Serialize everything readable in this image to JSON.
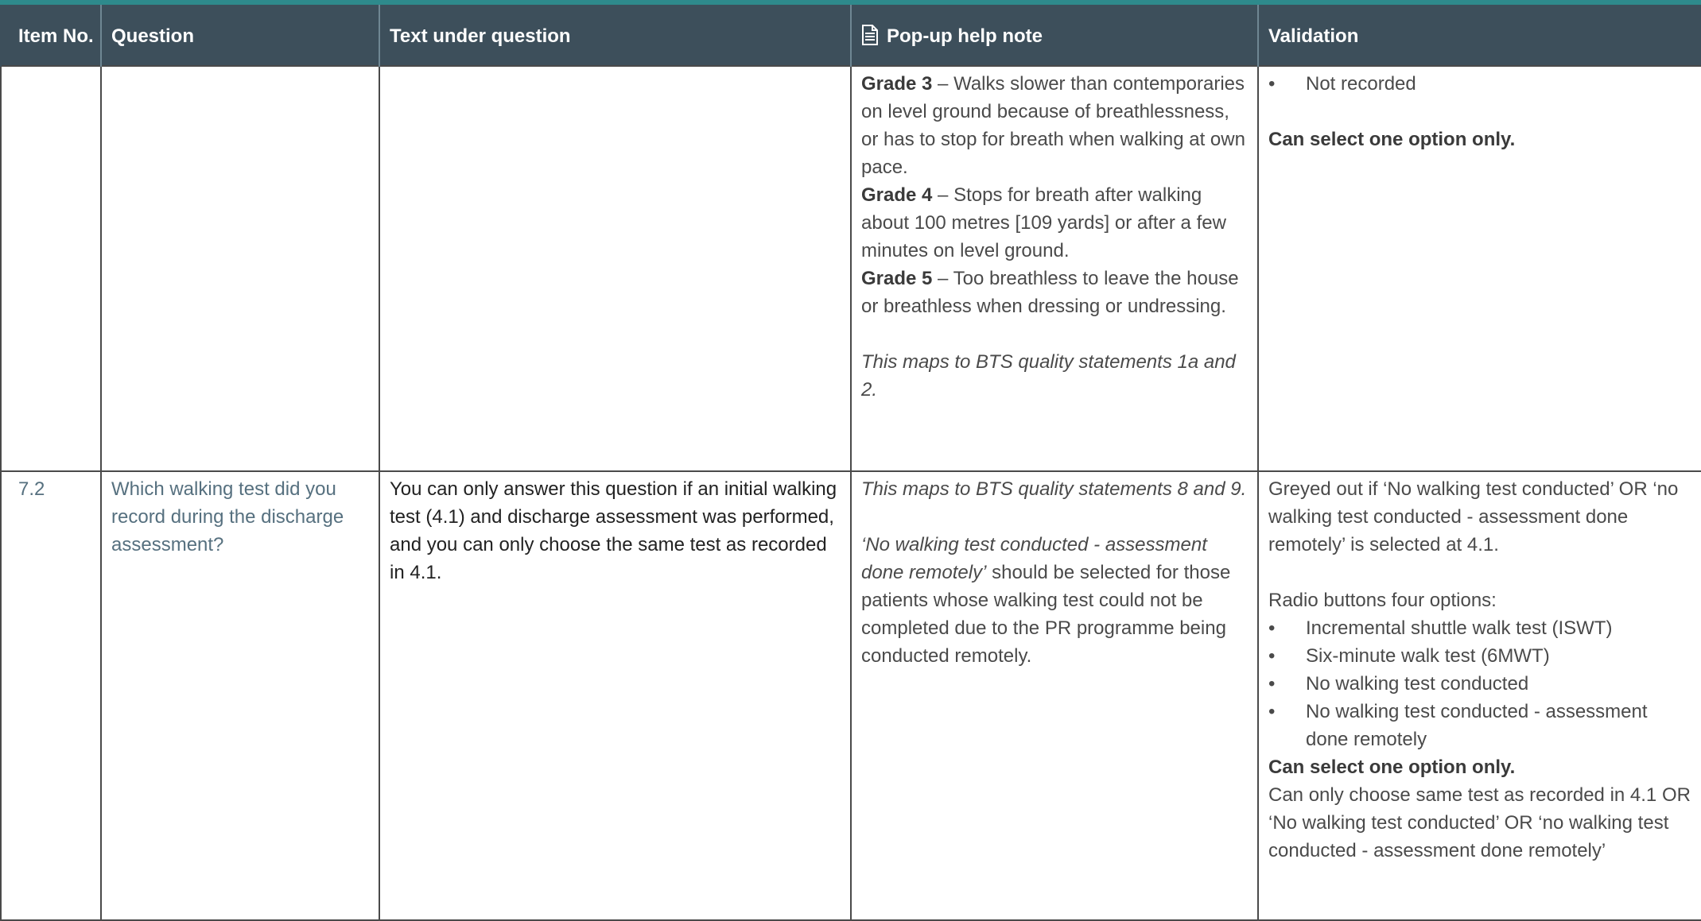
{
  "header": {
    "item_no": "Item No.",
    "question": "Question",
    "text_under": "Text under question",
    "help": "Pop-up help note",
    "help_icon": "document-icon",
    "validation": "Validation"
  },
  "colors": {
    "top_bar": "#2e8a8c",
    "header_bg": "#3d4f5b",
    "question_text": "#56707f"
  },
  "row1": {
    "item": "",
    "question": "",
    "text": "",
    "help": {
      "grades": [
        {
          "label": "Grade 3",
          "text": " – Walks slower than contemporaries on level ground because of breathlessness, or has to stop for breath when walking at own pace."
        },
        {
          "label": "Grade 4",
          "text": " – Stops for breath after walking about 100 metres [109 yards] or after a few minutes on level ground."
        },
        {
          "label": "Grade 5",
          "text": " – Too breathless to leave the house or breathless when dressing or undressing."
        }
      ],
      "maps": "This maps to BTS quality statements 1a and 2."
    },
    "validation": {
      "bullet": "Not recorded",
      "note": "Can select one option only."
    }
  },
  "row2": {
    "item": "7.2",
    "question": "Which walking test did you record during the discharge assessment?",
    "text": "You can only answer this question if an initial walking test (4.1) and discharge assessment was performed, and you can only choose the same test as recorded in 4.1.",
    "help": {
      "maps": "This maps to BTS quality statements 8 and 9.",
      "quote": "‘No walking test conducted - assessment done remotely’",
      "rest": " should be selected for those patients whose walking test could not be completed due to the PR programme being conducted remotely."
    },
    "validation": {
      "greyed": "Greyed out if ‘No walking test conducted’ OR ‘no walking test conducted - assessment done remotely’ is selected at 4.1.",
      "radio_intro": "Radio buttons four options:",
      "options": [
        "Incremental shuttle walk test (ISWT)",
        "Six-minute walk test (6MWT)",
        "No walking test conducted",
        "No walking test conducted - assessment done remotely"
      ],
      "note": "Can select one option only.",
      "choose": "Can only choose same test as recorded in 4.1 OR ‘No walking test conducted’ OR ‘no walking test conducted - assessment done remotely’"
    }
  }
}
